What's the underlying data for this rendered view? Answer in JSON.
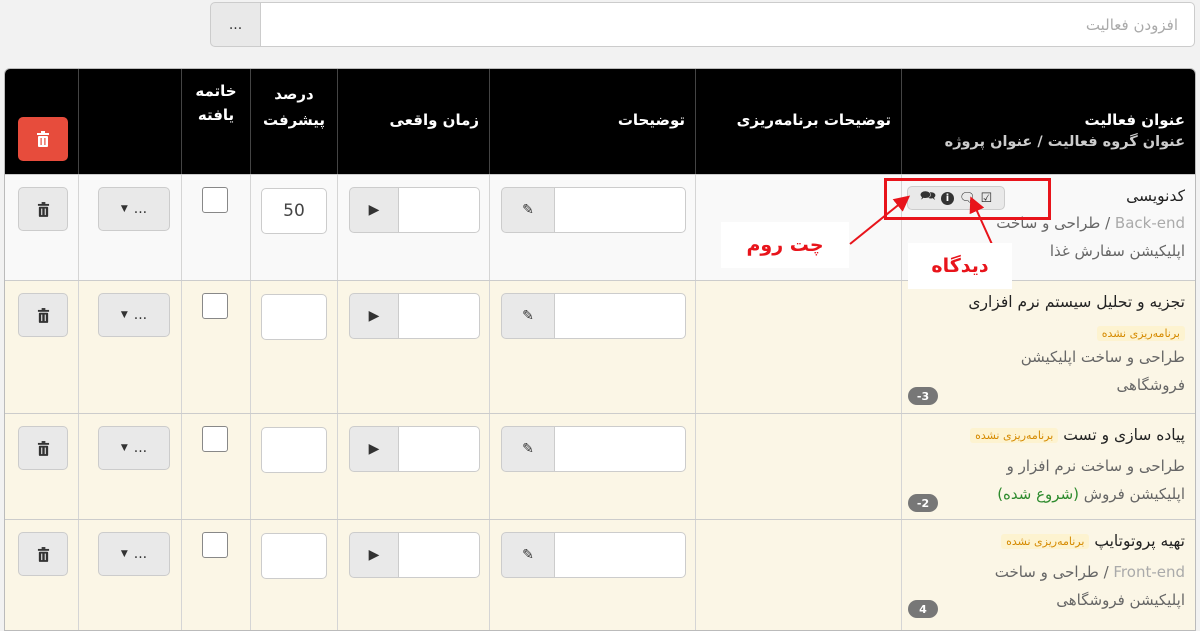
{
  "add_activity": {
    "placeholder": "افزودن فعالیت",
    "more_label": "..."
  },
  "header": {
    "activity_title": "عنوان فعالیت",
    "activity_group_title": "عنوان گروه فعالیت",
    "separator": "/",
    "project_title": "عنوان پروژه",
    "planning_notes": "توضیحات برنامه‌ریزی",
    "notes": "توضیحات",
    "actual_time": "زمان واقعی",
    "progress_line1": "درصد",
    "progress_line2": "پیشرفت",
    "done_line1": "خاتمه",
    "done_line2": "یافته"
  },
  "rows": [
    {
      "title": "کدنویسی",
      "group": "Back-end",
      "project_a": "طراحی و ساخت",
      "project_b": "اپلیکیشن سفارش غذا",
      "progress": "50",
      "more": "..."
    },
    {
      "title": "تجزیه و تحلیل سیستم نرم افزاری",
      "tag": "برنامه‌ریزی نشده",
      "project_a": "طراحی و ساخت اپلیکیشن",
      "project_b": "فروشگاهی",
      "count": "-3",
      "more": "..."
    },
    {
      "title": "پیاده سازی و تست",
      "tag": "برنامه‌ریزی نشده",
      "project_a": "طراحی و ساخت نرم افزار و",
      "project_b": "اپلیکیشن فروش",
      "status": "(شروع شده)",
      "count": "-2",
      "more": "..."
    },
    {
      "title": "تهیه پروتوتایپ",
      "tag": "برنامه‌ریزی نشده",
      "group": "Front-end",
      "project_a": "طراحی و ساخت",
      "project_b": "اپلیکیشن فروشگاهی",
      "count": "4",
      "more": "..."
    }
  ],
  "annotations": {
    "chatroom": "چت روم",
    "comments": "دیدگاه",
    "highlight_color": "#e8141b"
  },
  "colors": {
    "header_bg": "#000000",
    "delete_red": "#e74c3c",
    "row_alt": "#fbf6e6"
  }
}
